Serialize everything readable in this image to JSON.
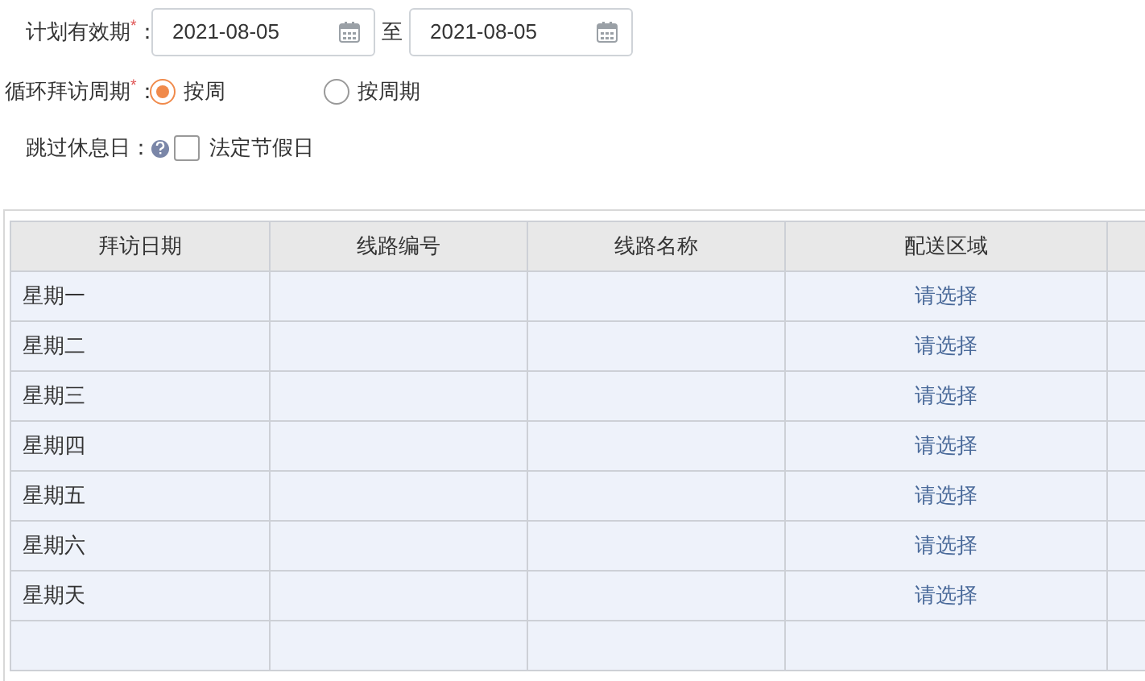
{
  "plan_period": {
    "label": "计划有效期",
    "mark": "*",
    "colon": "：",
    "start": "2021-08-05",
    "separator": "至",
    "end": "2021-08-05"
  },
  "cycle": {
    "label": "循环拜访周期",
    "mark": "*",
    "colon": "：",
    "options": [
      {
        "label": "按周",
        "selected": true
      },
      {
        "label": "按周期",
        "selected": false
      }
    ]
  },
  "skip_rest": {
    "label": "跳过休息日",
    "colon": "：",
    "option": {
      "label": "法定节假日",
      "checked": false
    }
  },
  "table": {
    "columns": [
      "拜访日期",
      "线路编号",
      "线路名称",
      "配送区域"
    ],
    "rows": [
      {
        "day": "星期一",
        "area": "请选择"
      },
      {
        "day": "星期二",
        "area": "请选择"
      },
      {
        "day": "星期三",
        "area": "请选择"
      },
      {
        "day": "星期四",
        "area": "请选择"
      },
      {
        "day": "星期五",
        "area": "请选择"
      },
      {
        "day": "星期六",
        "area": "请选择"
      },
      {
        "day": "星期天",
        "area": "请选择"
      }
    ]
  }
}
